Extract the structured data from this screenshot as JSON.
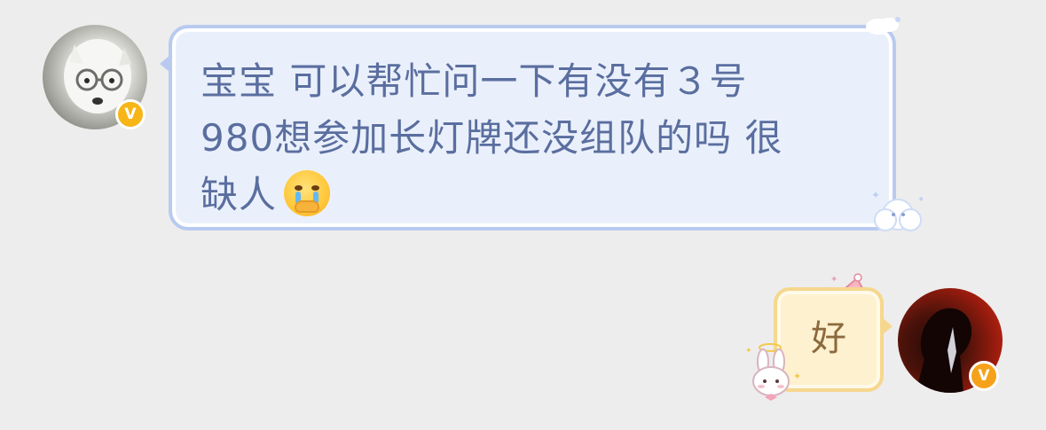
{
  "messages": {
    "incoming": {
      "text": "宝宝 可以帮忙问一下有没有３号\n980想参加长灯牌还没组队的吗 很\n缺人",
      "emoji": "crying-face-hands-over-mouth-emoji",
      "avatar_badge": "V",
      "bubble_colors": {
        "background": "#eaf0fb",
        "border": "#b9caf0",
        "text": "#5a6e9f"
      }
    },
    "outgoing": {
      "text": "好",
      "avatar_badge": "V",
      "bubble_colors": {
        "background": "#fdf1cf",
        "border": "#f5d78e",
        "text": "#8c6a3d"
      }
    }
  },
  "icons": {
    "verified_badge": "verified-v-icon",
    "left_avatar": "samoyed-dog-with-glasses-avatar",
    "right_avatar": "silhouette-red-background-avatar",
    "bubble_decoration_left": "cloud-sparkle-decoration",
    "bubble_decoration_right": "bunny-and-party-hat-decoration"
  },
  "colors": {
    "page_background": "#ededed",
    "badge": "#f7b516"
  }
}
